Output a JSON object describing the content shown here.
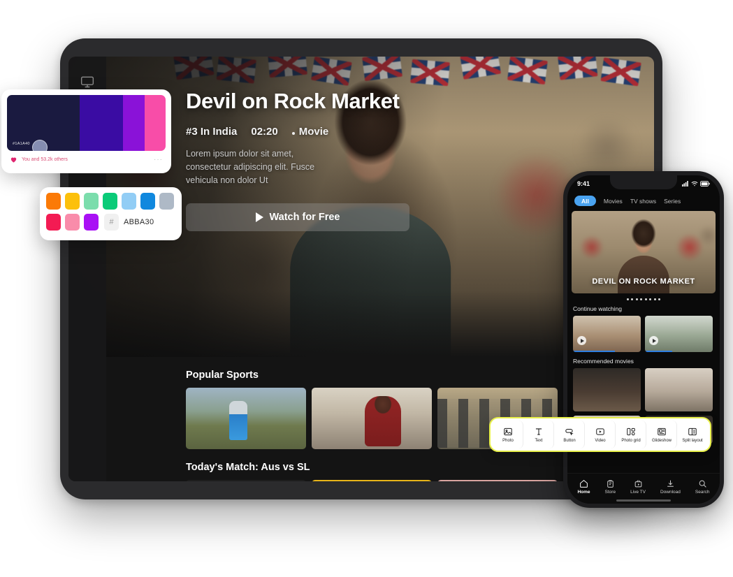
{
  "tablet": {
    "sidebar": [
      {
        "name": "tv-icon"
      },
      {
        "name": "film-strip-icon"
      },
      {
        "name": "trophy-icon"
      }
    ],
    "hero": {
      "title": "Devil on Rock Market",
      "rank": "#3 In India",
      "duration": "02:20",
      "type": "Movie",
      "description": "Lorem ipsum dolor sit amet, consectetur adipiscing elit. Fusce vehicula non dolor Ut",
      "cta": "Watch for Free"
    },
    "rows": [
      {
        "title": "Popular Sports"
      },
      {
        "title": "Today's Match: Aus vs SL"
      }
    ]
  },
  "phone": {
    "status": {
      "time": "9:41"
    },
    "tabs": [
      {
        "label": "All",
        "active": true
      },
      {
        "label": "Movies",
        "active": false
      },
      {
        "label": "TV shows",
        "active": false
      },
      {
        "label": "Series",
        "active": false
      }
    ],
    "hero_title": "DEVIL ON ROCK MARKET",
    "dots": 8,
    "sections": [
      {
        "title": "Continue watching"
      },
      {
        "title": "Recommended movies"
      }
    ],
    "bottom_nav": [
      {
        "label": "Home",
        "icon": "home-icon",
        "active": true
      },
      {
        "label": "Store",
        "icon": "store-icon",
        "active": false
      },
      {
        "label": "Live TV",
        "icon": "live-tv-icon",
        "active": false
      },
      {
        "label": "Download",
        "icon": "download-icon",
        "active": false
      },
      {
        "label": "Search",
        "icon": "search-icon",
        "active": false
      }
    ]
  },
  "toolbar": {
    "accent": "#E8F04A",
    "items": [
      {
        "label": "Photo",
        "icon": "photo-icon"
      },
      {
        "label": "Text",
        "icon": "text-icon"
      },
      {
        "label": "Button",
        "icon": "button-icon"
      },
      {
        "label": "Video",
        "icon": "video-icon"
      },
      {
        "label": "Photo grid",
        "icon": "photo-grid-icon"
      },
      {
        "label": "Glideshow",
        "icon": "glideshow-icon"
      },
      {
        "label": "Split layout",
        "icon": "split-layout-icon"
      }
    ]
  },
  "palette_gradient": {
    "hex_label": "#1A1A40",
    "likes_text": "You and 53.2k others",
    "bands": [
      {
        "color": "#1A1A40",
        "width": 46
      },
      {
        "color": "#3A0CA3",
        "width": 27
      },
      {
        "color": "#8A12D8",
        "width": 14
      },
      {
        "color": "#F84DA8",
        "width": 13
      }
    ]
  },
  "palette_swatches": {
    "hash_symbol": "#",
    "hex_value": "ABBA30",
    "row1": [
      "#FB7A07",
      "#FCC00B",
      "#7BDDAC",
      "#0ACB78",
      "#92CDF5",
      "#1088DE",
      "#AEB9C6"
    ],
    "row2": [
      "#F31B53",
      "#F98CAA",
      "#A910F5"
    ]
  }
}
